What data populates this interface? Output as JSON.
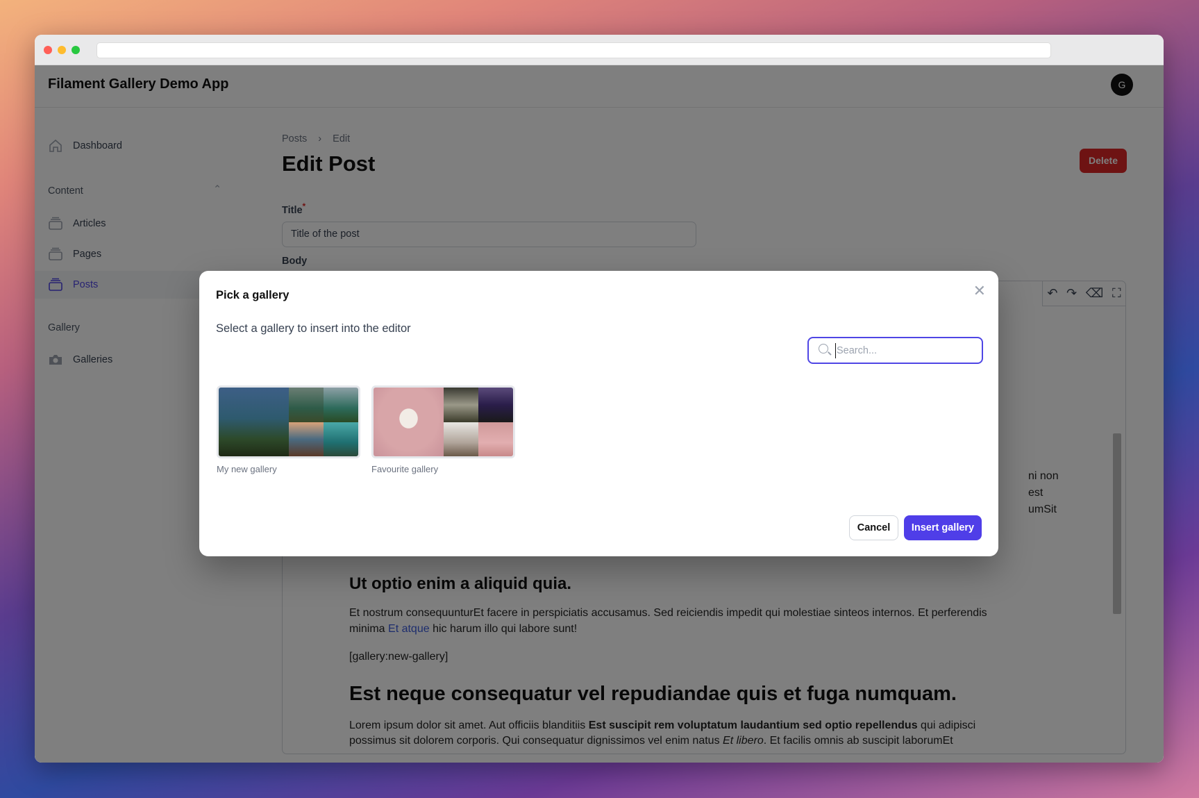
{
  "window": {
    "traffic_lights": [
      "#ff5f57",
      "#febc2e",
      "#28c840"
    ]
  },
  "header": {
    "app_title": "Filament Gallery Demo App",
    "avatar_initial": "G"
  },
  "sidebar": {
    "dashboard": "Dashboard",
    "groups": [
      {
        "label": "Content",
        "items": [
          "Articles",
          "Pages",
          "Posts"
        ]
      },
      {
        "label": "Gallery",
        "items": [
          "Galleries"
        ]
      }
    ],
    "active_item": "Posts"
  },
  "main": {
    "breadcrumb": [
      "Posts",
      "Edit"
    ],
    "page_title": "Edit Post",
    "delete_label": "Delete",
    "title_label": "Title",
    "title_value": "Title of the post",
    "body_label": "Body",
    "editor_toolbar": [
      "undo-icon",
      "redo-icon",
      "eraser-icon",
      "fullscreen-icon"
    ],
    "content": {
      "partial_lines": [
        "ni non",
        "est",
        "umSit"
      ],
      "h2": "Ut optio enim a aliquid quia.",
      "p1_line1": "Et nostrum consequunturEt facere in perspiciatis accusamus. Sed reiciendis impedit qui molestiae sinteos internos. Et perferendis",
      "p1_line2_pre": "minima ",
      "p1_link": "Et atque",
      "p1_line2_post": " hic harum illo qui labore sunt!",
      "shortcode": "[gallery:new-gallery]",
      "h1": "Est neque consequatur vel repudiandae quis et fuga numquam.",
      "p2_pre": "Lorem ipsum dolor sit amet. Aut officiis blanditiis ",
      "p2_bold": "Est suscipit rem voluptatum laudantium sed optio repellendus",
      "p2_post": " qui adipisci",
      "p2_line2_pre": "possimus sit dolorem corporis. Qui consequatur dignissimos vel enim natus ",
      "p2_italic": "Et libero",
      "p2_line2_post": ". Et facilis omnis ab suscipit laborumEt"
    }
  },
  "modal": {
    "title": "Pick a gallery",
    "subtitle": "Select a gallery to insert into the editor",
    "search_placeholder": "Search...",
    "galleries": [
      {
        "name": "My new gallery"
      },
      {
        "name": "Favourite gallery"
      }
    ],
    "cancel_label": "Cancel",
    "insert_label": "Insert gallery",
    "accent": "#4f46e5"
  }
}
